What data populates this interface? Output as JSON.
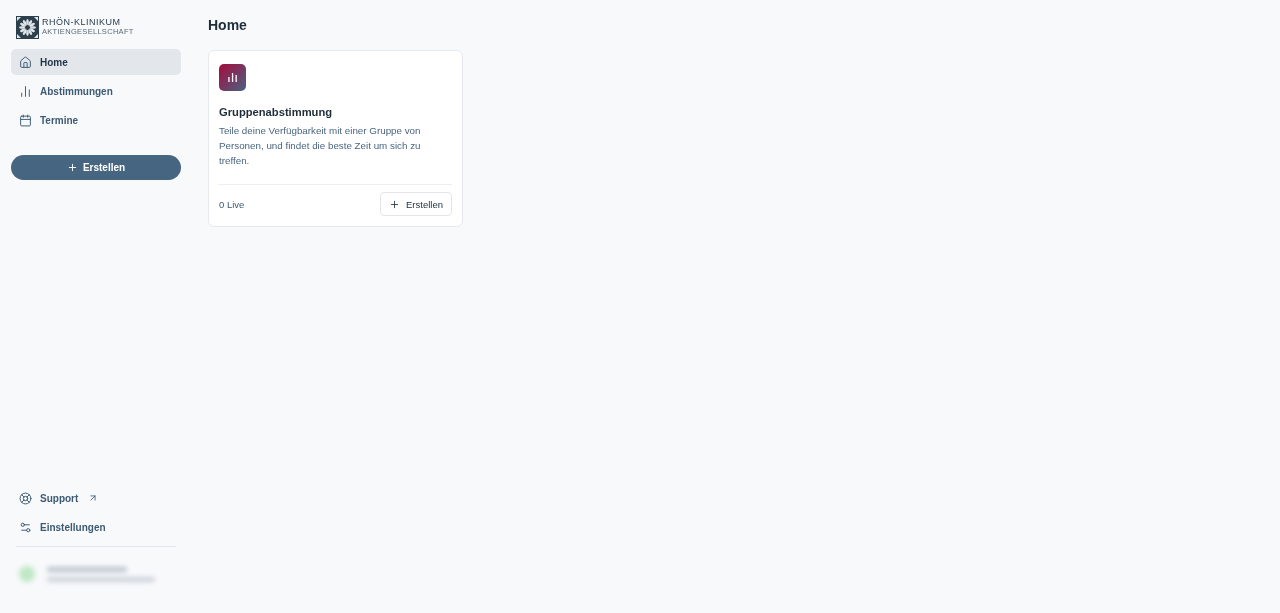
{
  "logo": {
    "name": "RHÖN-KLINIKUM",
    "subtitle": "AKTIENGESELLSCHAFT"
  },
  "nav": [
    {
      "label": "Home",
      "kind": "home",
      "selected": true
    },
    {
      "label": "Abstimmungen",
      "kind": "chart",
      "selected": false
    },
    {
      "label": "Termine",
      "kind": "calendar",
      "selected": false
    }
  ],
  "create_button": {
    "label": "Erstellen"
  },
  "footer_links": [
    {
      "label": "Support",
      "kind": "support",
      "external": true
    },
    {
      "label": "Einstellungen",
      "kind": "settings",
      "external": false
    }
  ],
  "page": {
    "title": "Home"
  },
  "cards": [
    {
      "title": "Gruppenabstimmung",
      "description": "Teile deine Verfügbarkeit mit einer Gruppe von Personen, und findet die beste Zeit um sich zu treffen.",
      "live_count": "0 Live",
      "button": "Erstellen"
    }
  ]
}
